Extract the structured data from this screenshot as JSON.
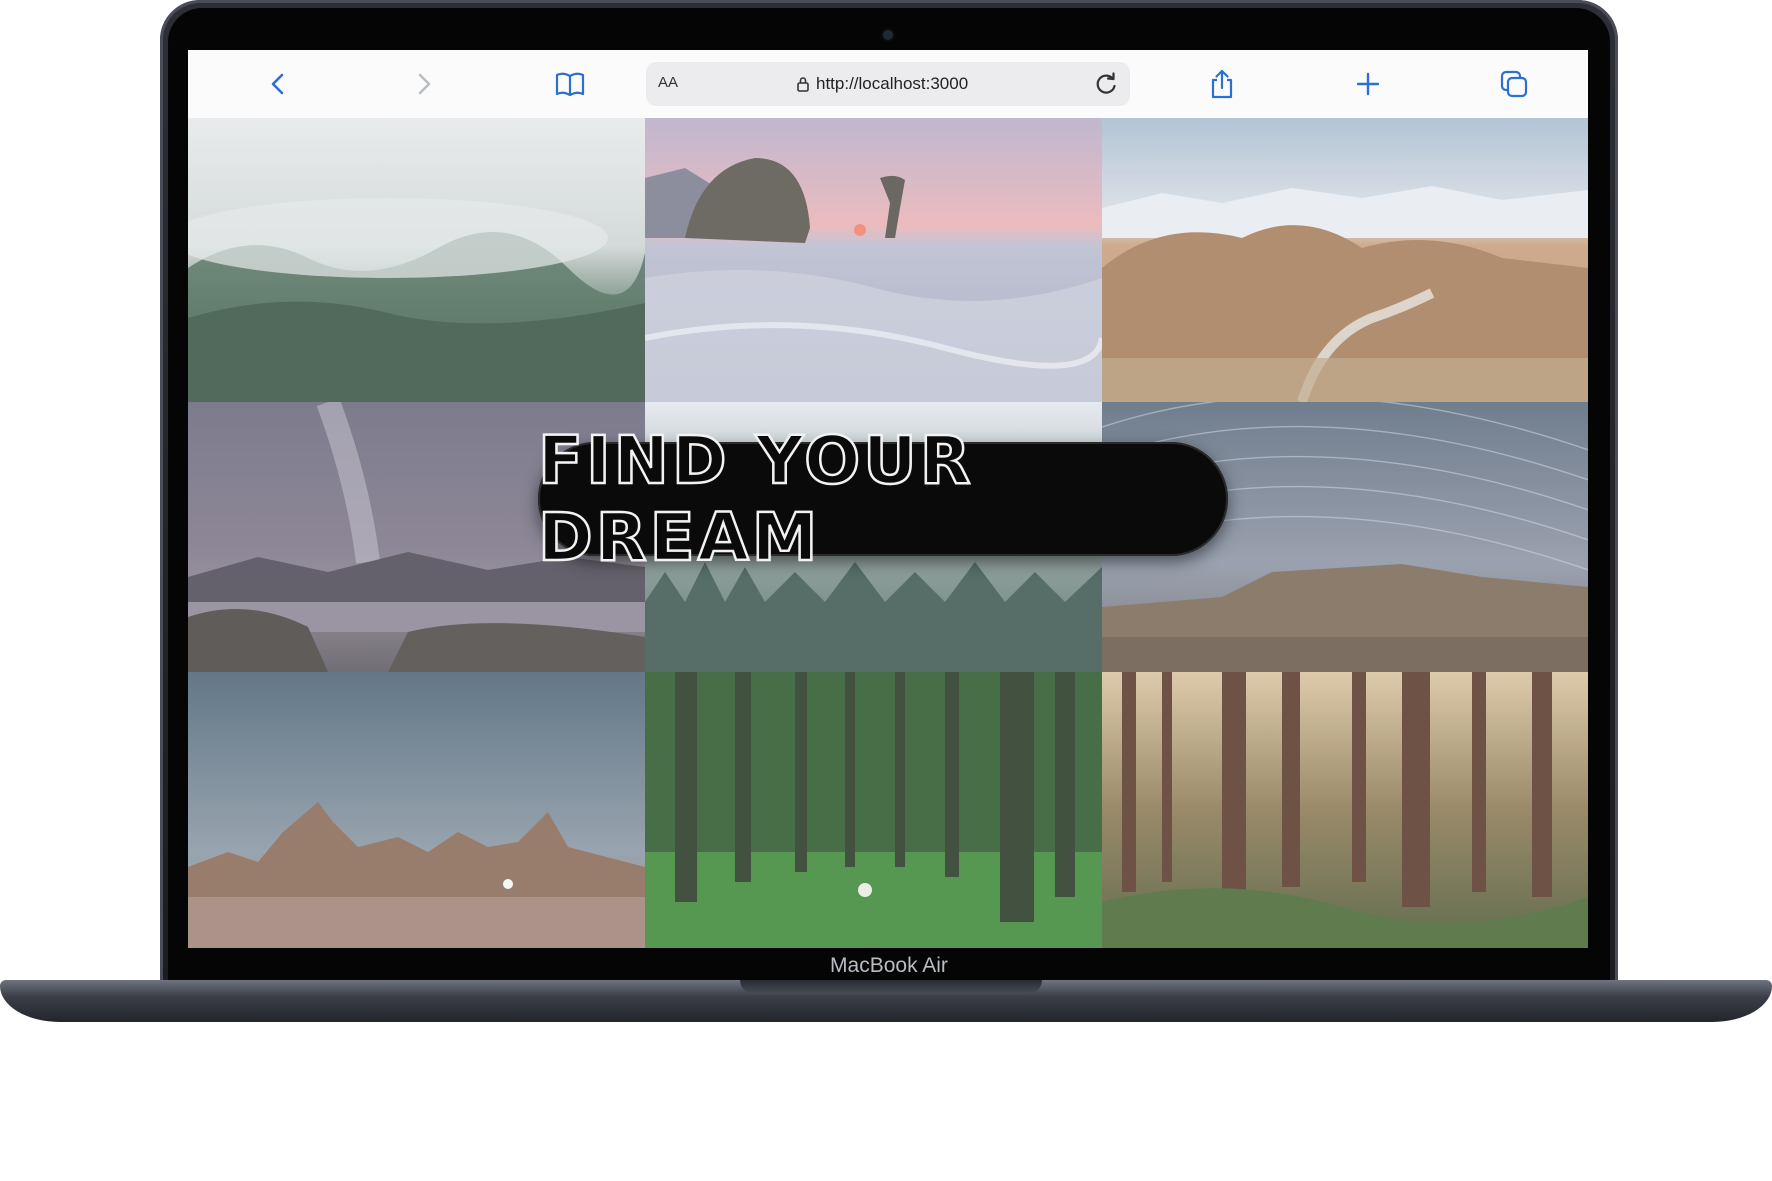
{
  "device": {
    "label": "MacBook Air",
    "body_color": "#2d2f36"
  },
  "browser": {
    "text_size_button": "AA",
    "url": "http://localhost:3000",
    "icons": {
      "back": "chevron-left-icon",
      "forward": "chevron-right-icon",
      "bookmarks": "book-icon",
      "lock": "lock-icon",
      "reload": "reload-icon",
      "share": "share-icon",
      "new_tab": "plus-icon",
      "tabs": "tabs-icon"
    },
    "accent_color": "#2d6fd1"
  },
  "page": {
    "headline": "FIND YOUR DREAM",
    "gallery": [
      {
        "id": "foggy-forest"
      },
      {
        "id": "sea-rocks-sunset"
      },
      {
        "id": "desert-mountains"
      },
      {
        "id": "milky-way-lake"
      },
      {
        "id": "misty-forest"
      },
      {
        "id": "star-trails-mesa"
      },
      {
        "id": "night-desert-pinnacles"
      },
      {
        "id": "green-forest-hiker"
      },
      {
        "id": "redwood-forest"
      }
    ]
  }
}
